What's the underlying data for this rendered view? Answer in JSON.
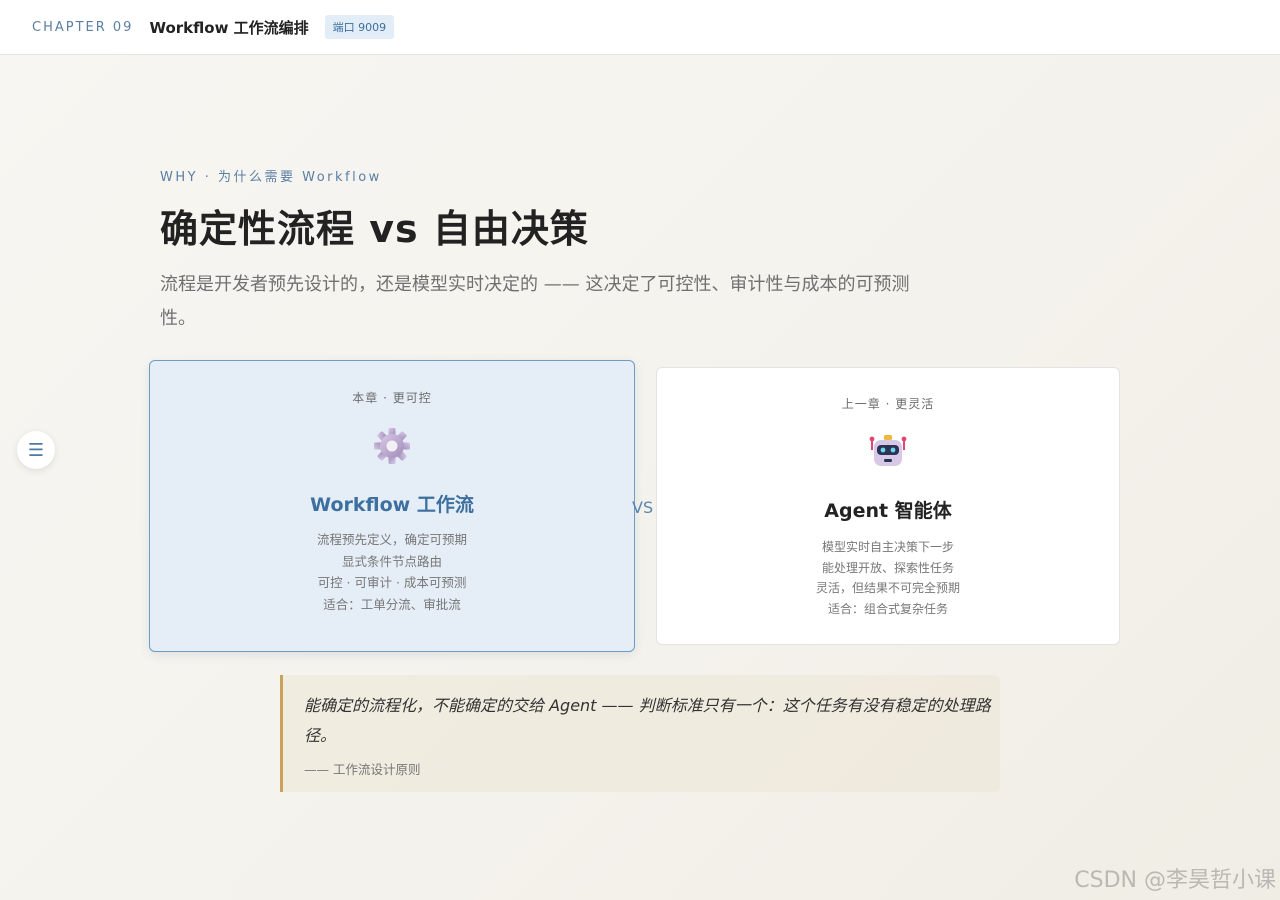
{
  "header": {
    "chapter": "CHAPTER 09",
    "title": "Workflow 工作流编排",
    "port_badge": "端口 9009"
  },
  "hero": {
    "eyebrow": "WHY · 为什么需要 Workflow",
    "headline": "确定性流程 vs 自由决策",
    "subhead": "流程是开发者预先设计的，还是模型实时决定的 —— 这决定了可控性、审计性与成本的可预测性。"
  },
  "nav": {
    "menu_icon": "menu-icon"
  },
  "cards": {
    "workflow": {
      "tag": "本章 · 更可控",
      "icon": "gear-icon",
      "title": "Workflow 工作流",
      "lines": [
        "流程预先定义，确定可预期",
        "显式条件节点路由",
        "可控 · 可审计 · 成本可预测",
        "适合：工单分流、审批流"
      ],
      "accent": "#3d6f9f"
    },
    "vs": "VS",
    "agent": {
      "tag": "上一章 · 更灵活",
      "icon": "robot-icon",
      "title": "Agent 智能体",
      "lines": [
        "模型实时自主决策下一步",
        "能处理开放、探索性任务",
        "灵活，但结果不可完全预期",
        "适合：组合式复杂任务"
      ]
    }
  },
  "quote": {
    "text": "能确定的流程化，不能确定的交给 Agent —— 判断标准只有一个：这个任务有没有稳定的处理路径。",
    "source": "—— 工作流设计原则",
    "accent": "#c9a35c"
  },
  "watermark": "CSDN @李昊哲小课"
}
